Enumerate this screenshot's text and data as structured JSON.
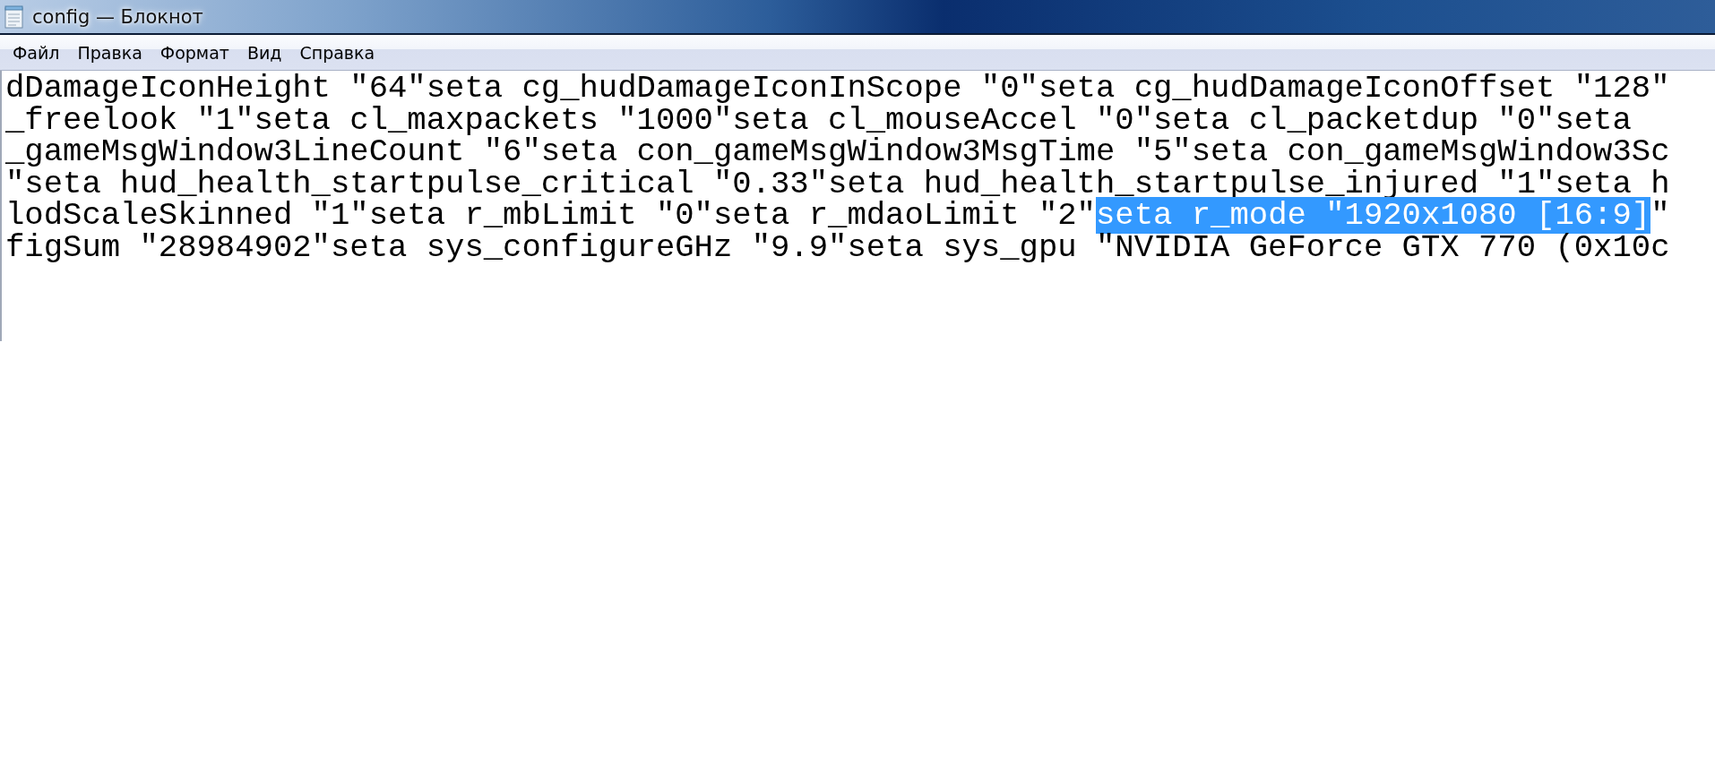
{
  "window": {
    "title": "config — Блокнот"
  },
  "menu": [
    "Файл",
    "Правка",
    "Формат",
    "Вид",
    "Справка"
  ],
  "editor": {
    "lines": [
      {
        "segments": [
          {
            "text": "dDamageIconHeight \"64\"seta cg_hudDamageIconInScope \"0\"seta cg_hudDamageIconOffset \"128\"",
            "selected": false
          }
        ]
      },
      {
        "segments": [
          {
            "text": "_freelook \"1\"seta cl_maxpackets \"1000\"seta cl_mouseAccel \"0\"seta cl_packetdup \"0\"seta",
            "selected": false
          }
        ]
      },
      {
        "segments": [
          {
            "text": "_gameMsgWindow3LineCount \"6\"seta con_gameMsgWindow3MsgTime \"5\"seta con_gameMsgWindow3Sc",
            "selected": false
          }
        ]
      },
      {
        "segments": [
          {
            "text": "\"seta hud_health_startpulse_critical \"0.33\"seta hud_health_startpulse_injured \"1\"seta h",
            "selected": false
          }
        ]
      },
      {
        "segments": [
          {
            "text": "lodScaleSkinned \"1\"seta r_mbLimit \"0\"seta r_mdaoLimit \"2\"",
            "selected": false
          },
          {
            "text": "seta r_mode \"1920x1080 [16:9]",
            "selected": true
          },
          {
            "text": "\"",
            "selected": false
          }
        ]
      },
      {
        "segments": [
          {
            "text": "figSum \"28984902\"seta sys_configureGHz \"9.9\"seta sys_gpu \"NVIDIA GeForce GTX 770 (0x10c",
            "selected": false
          }
        ]
      }
    ]
  }
}
